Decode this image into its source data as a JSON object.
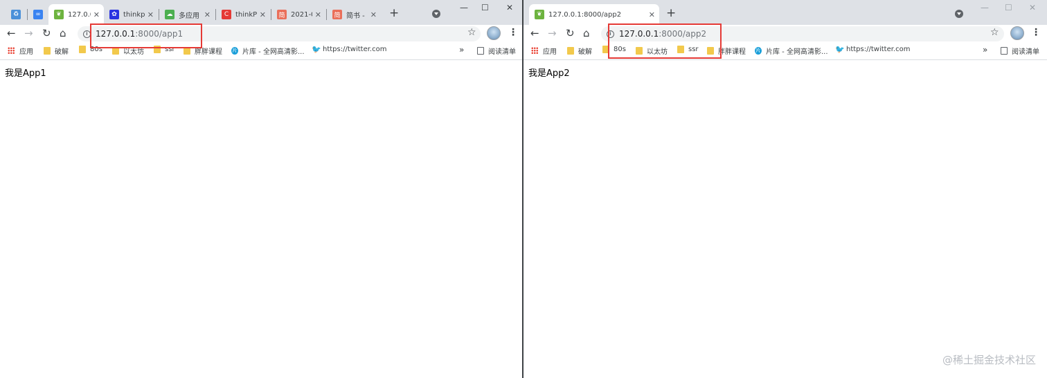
{
  "left": {
    "tabs": [
      {
        "label": "",
        "icon": "recycle-icon",
        "color": "#4a90d9"
      },
      {
        "label": "",
        "icon": "link-icon",
        "color": "#3a83f1"
      },
      {
        "label": "127.0.0",
        "icon": "leaf-icon",
        "color": "#6db33f"
      },
      {
        "label": "thinkp",
        "icon": "paw-icon",
        "color": "#2932e1"
      },
      {
        "label": "多应用",
        "icon": "cloud-icon",
        "color": "#4caf50"
      },
      {
        "label": "thinkP",
        "icon": "c-icon",
        "color": "#e53935"
      },
      {
        "label": "2021-0",
        "icon": "jian-icon",
        "color": "#ea6f5a"
      },
      {
        "label": "简书 -",
        "icon": "jian-icon",
        "color": "#ea6f5a"
      }
    ],
    "url_host": "127.0.0.1",
    "url_path": ":8000/app1",
    "page_text": "我是App1"
  },
  "right": {
    "tab_label": "127.0.0.1:8000/app2",
    "url_host": "127.0.0.1",
    "url_path": ":8000/app2",
    "page_text": "我是App2"
  },
  "favicon_glyphs": {
    "c": "C",
    "jian": "简",
    "pk": "片"
  },
  "bookmarks": {
    "apps": "应用",
    "items": [
      "破解",
      "80s",
      "以太坊",
      "ssr",
      "胖胖课程"
    ],
    "pianku": "片库 - 全网高清影...",
    "twitter": "https://twitter.com",
    "more": "»",
    "reading_list": "阅读清单"
  },
  "colors": {
    "highlight": "#e53935",
    "tabstrip": "#dee1e6"
  },
  "watermark": "@稀土掘金技术社区"
}
